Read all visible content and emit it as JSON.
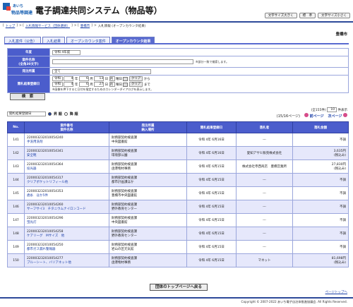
{
  "header": {
    "logo_line1": "あいち",
    "logo_line2": "物品等調達",
    "title": "電子調達共同システム（物品等）",
    "buttons": [
      "文字サイズ大きく",
      "標　準",
      "文字サイズ小さく"
    ]
  },
  "breadcrumb": [
    "トップ",
    "入札情報サービス（団体選択）",
    "豊橋市",
    "入札情報 (オープンカウンタ結果)"
  ],
  "region": "豊橋市",
  "tabs": [
    "入札案件（公告）",
    "入札結果",
    "オープンカウンタ案件",
    "オープンカウンタ結果"
  ],
  "search": {
    "nendo_label": "年度",
    "nendo_value": "令和 4年度",
    "name_label": "案件名称\n(全角30文字)",
    "name_note": "※部分一致で検索します。",
    "org_label": "発注所属",
    "org_value": "全て",
    "date_label": "開札結果登録日",
    "date_from": {
      "era": "令和",
      "y": "4",
      "m": "6",
      "d": "13",
      "day": "月"
    },
    "date_to": {
      "era": "令和",
      "y": "4",
      "m": "6",
      "d": "27",
      "day": "月"
    },
    "unit_y": "年",
    "unit_m": "月",
    "unit_d": "日",
    "unit_day": "曜日",
    "clear": "クリア",
    "from_label": "から",
    "to_label": "まで",
    "cal_note": "※画像を押下すると日付を指定するためのカレンダーダイアログを表示します。",
    "search_button": "検　索"
  },
  "controls": {
    "sort_value": "開札結果登録日",
    "asc": "昇 順",
    "desc": "降 順",
    "count_text": "全155件",
    "per_page": "10",
    "per_page_unit": "件表示",
    "page_info": "15/16ページ",
    "prev": "前ページ",
    "next": "次ページ"
  },
  "columns": [
    "No.",
    "案件番号\n案件名称",
    "発注所属\n納入場所",
    "開札結果登録日",
    "落札者",
    "落札金額"
  ],
  "rows": [
    {
      "no": "141",
      "id": "220003232010054240",
      "name": "手洗用洗剤",
      "org": "財務部契約検査課",
      "place": "中央図書館",
      "date": "令和 4年 6月16日",
      "winner": "---",
      "amount": "不調"
    },
    {
      "no": "142",
      "id": "220003232010054341",
      "name": "安全靴",
      "org": "財務部契約検査課",
      "place": "環境部公園",
      "date": "令和 4年 6月16日",
      "winner": "愛知アサヒ販売株式会社",
      "amount": "3,635円\n(税込み)"
    },
    {
      "no": "143",
      "id": "220003232010054364",
      "name": "投光器",
      "org": "財務部契約検査課",
      "place": "函港物材事務",
      "date": "令和 4年 6月15日",
      "winner": "株式会社寺西商店　豊橋営業所",
      "amount": "27,830円\n(税込み)"
    },
    {
      "no": "144",
      "id": "220003232010054317",
      "name": "クリアポケットリフィール他",
      "org": "財務部契約検査課",
      "place": "都市計画課ほか",
      "date": "令和 4年 6月15日",
      "winner": "---",
      "amount": "不調"
    },
    {
      "no": "145",
      "id": "220003232010054353",
      "name": "歳糸　ほか5件",
      "org": "財務部契約検査課",
      "place": "豊橋市中央図書館",
      "date": "令和 4年 6月15日",
      "winner": "---",
      "amount": "不調"
    },
    {
      "no": "146",
      "id": "220003232010054260",
      "name": "サーフサイ3　チタニウムナイロンコード",
      "org": "財務部契約検査課",
      "place": "野外教育センター",
      "date": "令和 4年 6月15日",
      "winner": "---",
      "amount": "不調"
    },
    {
      "no": "147",
      "id": "220003232010054296",
      "name": "蛍光灯",
      "org": "財務部契約検査課",
      "place": "中央図書館",
      "date": "令和 4年 6月15日",
      "winner": "---",
      "amount": "不調"
    },
    {
      "no": "148",
      "id": "220003232010054258",
      "name": "ケアリーグ　Mサイズ　他",
      "org": "財務部契約検査課",
      "place": "野外教育センター",
      "date": "令和 4年 6月15日",
      "winner": "---",
      "amount": "不調"
    },
    {
      "no": "149",
      "id": "220003232010054250",
      "name": "都市ガス漏れ警報器",
      "org": "財務部契約検査課",
      "place": "岩山の区元気館",
      "date": "令和 4年 6月15日",
      "winner": "---",
      "amount": "不調"
    },
    {
      "no": "150",
      "id": "220003232010054277",
      "name": "ブルーシート、バリアネット他",
      "org": "財務部契約検査課",
      "place": "函港物材事務",
      "date": "令和 4年 6月15日",
      "winner": "マネット",
      "amount": "81,698円\n(税込み)"
    }
  ],
  "back_button": "団体のトップページへ戻る",
  "page_top": "ページトップへ",
  "footer": "Copyright © 2007-2022 あいち電子自治体推進協議会. All Rights Reserved."
}
